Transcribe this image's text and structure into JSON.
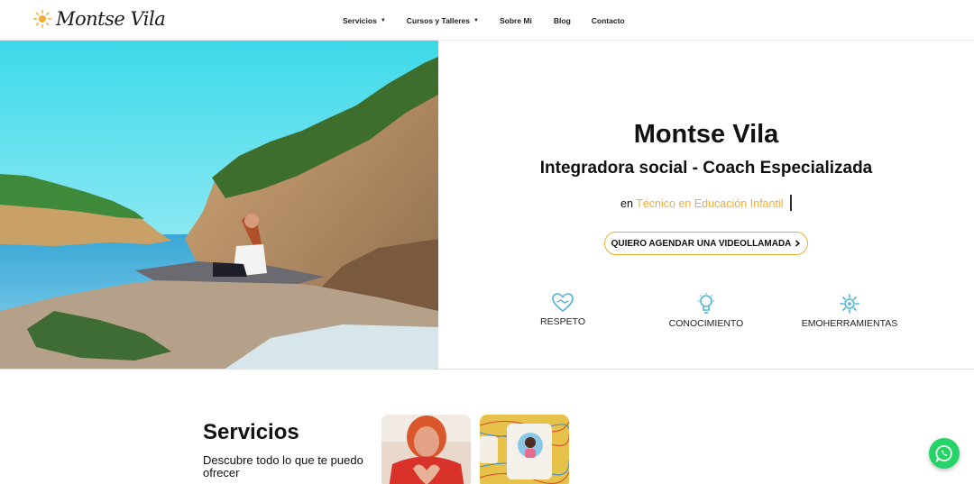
{
  "header": {
    "logo_text": "Montse Vila",
    "nav": [
      {
        "label": "Servicios",
        "has_dropdown": true
      },
      {
        "label": "Cursos y Talleres",
        "has_dropdown": true
      },
      {
        "label": "Sobre Mi",
        "has_dropdown": false
      },
      {
        "label": "Blog",
        "has_dropdown": false
      },
      {
        "label": "Contacto",
        "has_dropdown": false
      }
    ]
  },
  "hero": {
    "name": "Montse Vila",
    "role": "Integradora social - Coach Especializada",
    "spec_prefix": "en",
    "spec_accent": "Técnico en Educación Infantil",
    "cta_label": "QUIERO AGENDAR UNA VIDEOLLAMADA",
    "cta_icon": "chevron-right-icon",
    "values": [
      {
        "label": "RESPETO",
        "icon": "handshake-heart-icon"
      },
      {
        "label": "CONOCIMIENTO",
        "icon": "lightbulb-icon"
      },
      {
        "label": "EMOHERRAMIENTAS",
        "icon": "brain-gear-icon"
      }
    ]
  },
  "services": {
    "title": "Servicios",
    "subtitle": "Descubre todo lo que te puedo ofrecer"
  },
  "colors": {
    "accent": "#f0ad31",
    "icon_blue": "#4fb3d9",
    "whatsapp": "#25d366"
  },
  "floating": {
    "whatsapp_icon": "whatsapp-icon"
  }
}
